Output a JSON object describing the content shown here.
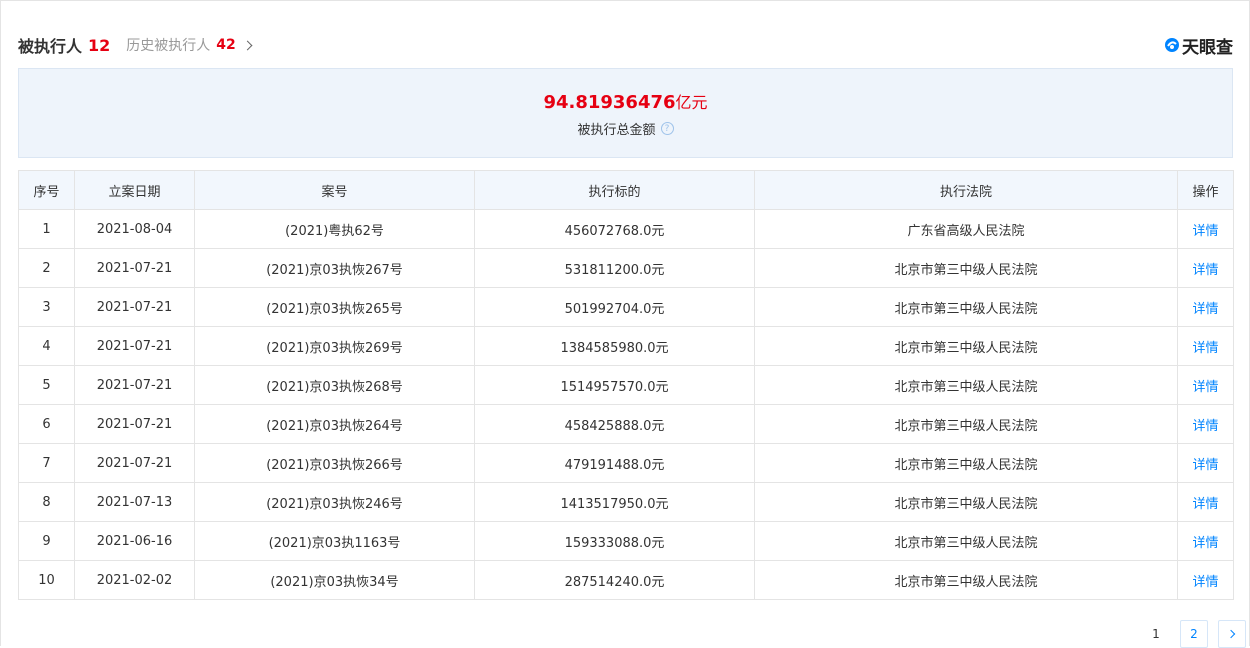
{
  "header": {
    "title": "被执行人",
    "count": "12",
    "history_label": "历史被执行人",
    "history_count": "42",
    "logo_text": "天眼查"
  },
  "summary": {
    "amount": "94.81936476",
    "unit": "亿元",
    "label": "被执行总金额"
  },
  "table": {
    "columns": [
      "序号",
      "立案日期",
      "案号",
      "执行标的",
      "执行法院",
      "操作"
    ],
    "rows": [
      [
        "1",
        "2021-08-04",
        "(2021)粤执62号",
        "456072768.0元",
        "广东省高级人民法院",
        "详情"
      ],
      [
        "2",
        "2021-07-21",
        "(2021)京03执恢267号",
        "531811200.0元",
        "北京市第三中级人民法院",
        "详情"
      ],
      [
        "3",
        "2021-07-21",
        "(2021)京03执恢265号",
        "501992704.0元",
        "北京市第三中级人民法院",
        "详情"
      ],
      [
        "4",
        "2021-07-21",
        "(2021)京03执恢269号",
        "1384585980.0元",
        "北京市第三中级人民法院",
        "详情"
      ],
      [
        "5",
        "2021-07-21",
        "(2021)京03执恢268号",
        "1514957570.0元",
        "北京市第三中级人民法院",
        "详情"
      ],
      [
        "6",
        "2021-07-21",
        "(2021)京03执恢264号",
        "458425888.0元",
        "北京市第三中级人民法院",
        "详情"
      ],
      [
        "7",
        "2021-07-21",
        "(2021)京03执恢266号",
        "479191488.0元",
        "北京市第三中级人民法院",
        "详情"
      ],
      [
        "8",
        "2021-07-13",
        "(2021)京03执恢246号",
        "1413517950.0元",
        "北京市第三中级人民法院",
        "详情"
      ],
      [
        "9",
        "2021-06-16",
        "(2021)京03执1163号",
        "159333088.0元",
        "北京市第三中级人民法院",
        "详情"
      ],
      [
        "10",
        "2021-02-02",
        "(2021)京03执恢34号",
        "287514240.0元",
        "北京市第三中级人民法院",
        "详情"
      ]
    ]
  },
  "pager": {
    "current": "1",
    "next_page": "2"
  },
  "colors": {
    "accent": "#0084ff",
    "highlight": "#e60012",
    "summary_bg": "#eef4fb"
  }
}
